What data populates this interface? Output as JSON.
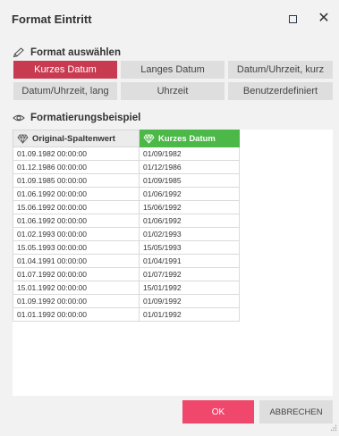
{
  "window": {
    "title": "Format Eintritt",
    "maximize_icon": "maximize-icon",
    "close_glyph": "✕"
  },
  "format_section": {
    "label": "Format auswählen",
    "icon": "pencil-icon",
    "buttons": [
      {
        "label": "Kurzes Datum",
        "active": true
      },
      {
        "label": "Langes Datum",
        "active": false
      },
      {
        "label": "Datum/Uhrzeit, kurz",
        "active": false
      },
      {
        "label": "Datum/Uhrzeit, lang",
        "active": false
      },
      {
        "label": "Uhrzeit",
        "active": false
      },
      {
        "label": "Benutzerdefiniert",
        "active": false
      }
    ]
  },
  "example_section": {
    "label": "Formatierungsbeispiel",
    "icon": "eye-icon",
    "columns": [
      {
        "label": "Original-Spaltenwert",
        "icon": "diamond-icon"
      },
      {
        "label": "Kurzes Datum",
        "icon": "diamond-icon"
      }
    ],
    "rows": [
      [
        "01.09.1982 00:00:00",
        "01/09/1982"
      ],
      [
        "01.12.1986 00:00:00",
        "01/12/1986"
      ],
      [
        "01.09.1985 00:00:00",
        "01/09/1985"
      ],
      [
        "01.06.1992 00:00:00",
        "01/06/1992"
      ],
      [
        "15.06.1992 00:00:00",
        "15/06/1992"
      ],
      [
        "01.06.1992 00:00:00",
        "01/06/1992"
      ],
      [
        "01.02.1993 00:00:00",
        "01/02/1993"
      ],
      [
        "15.05.1993 00:00:00",
        "15/05/1993"
      ],
      [
        "01.04.1991 00:00:00",
        "01/04/1991"
      ],
      [
        "01.07.1992 00:00:00",
        "01/07/1992"
      ],
      [
        "15.01.1992 00:00:00",
        "15/01/1992"
      ],
      [
        "01.09.1992 00:00:00",
        "01/09/1992"
      ],
      [
        "01.01.1992 00:00:00",
        "01/01/1992"
      ]
    ]
  },
  "footer": {
    "ok_label": "OK",
    "cancel_label": "ABBRECHEN"
  },
  "colors": {
    "active_button": "#c83a50",
    "ok_button": "#f0476c",
    "highlight_column": "#4cb848"
  }
}
